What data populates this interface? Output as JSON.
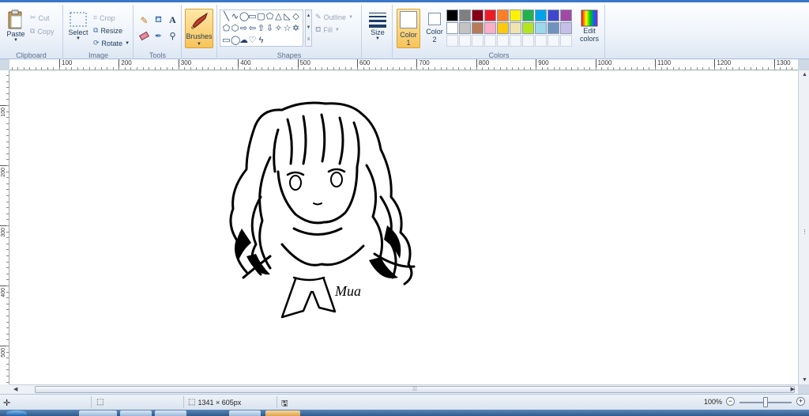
{
  "ribbon": {
    "clipboard": {
      "label": "Clipboard",
      "paste": "Paste",
      "cut": "Cut",
      "copy": "Copy"
    },
    "image": {
      "label": "Image",
      "select": "Select",
      "crop": "Crop",
      "resize": "Resize",
      "rotate": "Rotate"
    },
    "tools": {
      "label": "Tools"
    },
    "brushes": {
      "label": "Brushes"
    },
    "shapes": {
      "label": "Shapes",
      "outline": "Outline",
      "fill": "Fill",
      "items": [
        "line-shape",
        "curve-shape",
        "oval-shape",
        "rectangle-shape",
        "rounded-rectangle-shape",
        "polygon-shape",
        "triangle-shape",
        "right-triangle-shape",
        "diamond-shape",
        "pentagon-shape",
        "hexagon-shape",
        "right-arrow-shape",
        "left-arrow-shape",
        "up-arrow-shape",
        "down-arrow-shape",
        "four-point-star-shape",
        "five-point-star-shape",
        "six-point-star-shape",
        "rounded-callout-shape",
        "oval-callout-shape",
        "cloud-callout-shape",
        "heart-shape",
        "lightning-shape"
      ],
      "glyphs": [
        "╲",
        "∿",
        "◯",
        "▭",
        "▢",
        "⬠",
        "△",
        "◺",
        "◇",
        "⬠",
        "⬡",
        "⇨",
        "⇦",
        "⇧",
        "⇩",
        "✧",
        "☆",
        "✡",
        "▭",
        "◯",
        "☁",
        "♡",
        "ϟ"
      ]
    },
    "size": {
      "label": "Size"
    },
    "color1": {
      "label": "Color",
      "num": "1",
      "value": "#ffffff"
    },
    "color2": {
      "label": "Color",
      "num": "2",
      "value": "#ffffff"
    },
    "colors": {
      "label": "Colors",
      "swatches": [
        "#000000",
        "#7f7f7f",
        "#880015",
        "#ed1c24",
        "#ff7f27",
        "#fff200",
        "#22b14c",
        "#00a2e8",
        "#3f48cc",
        "#a349a4",
        "#ffffff",
        "#c3c3c3",
        "#b97a57",
        "#ffaec9",
        "#ffc90e",
        "#efe4b0",
        "#b5e61d",
        "#99d9ea",
        "#7092be",
        "#c8bfe7"
      ],
      "empty_slots": 10
    },
    "edit_colors": {
      "label1": "Edit",
      "label2": "colors"
    }
  },
  "rulers": {
    "horizontal": [
      "100",
      "200",
      "300",
      "400",
      "500",
      "600",
      "700",
      "800",
      "900",
      "1000",
      "1100",
      "1200",
      "1300"
    ],
    "vertical": [
      "100",
      "200",
      "300",
      "400",
      "500"
    ]
  },
  "drawing": {
    "signature": "Mua"
  },
  "status": {
    "dimensions": "1341 × 605px",
    "zoom": "100%"
  }
}
